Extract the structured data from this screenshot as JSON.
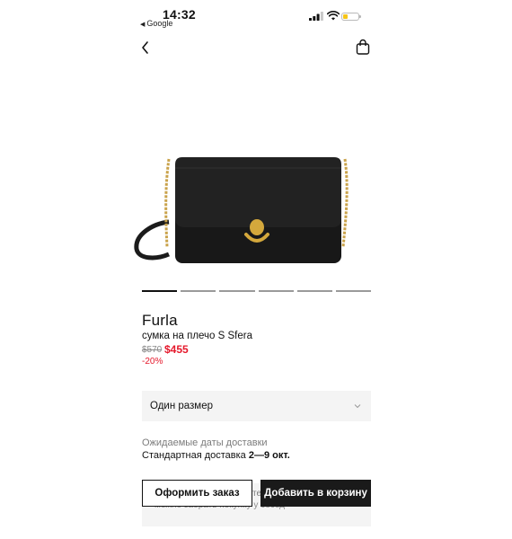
{
  "status_bar": {
    "time": "14:32",
    "back_app": "Google",
    "back_arrow": "◀",
    "icons": [
      "signal-icon",
      "wifi-icon",
      "battery-icon"
    ],
    "battery_color": "#f5c518"
  },
  "nav": {
    "back_icon": "chevron-left-icon",
    "bag_icon": "shopping-bag-icon"
  },
  "carousel": {
    "total": 6,
    "active_index": 0
  },
  "product": {
    "brand": "Furla",
    "name": "сумка на плечо S Sfera",
    "old_price": "$570",
    "price": "$455",
    "discount": "-20%",
    "image_icon": "black-shoulder-bag-with-gold-chain"
  },
  "size_select": {
    "value": "Один размер",
    "icon": "chevron-down-icon"
  },
  "delivery": {
    "title": "Ожидаемые даты доставки",
    "method": "Стандартная доставка",
    "dates": "2—9 окт."
  },
  "behind_buttons": {
    "line1": "те",
    "line2": "можно забрать покупку у сосед"
  },
  "actions": {
    "order": "Оформить заказ",
    "add_to_cart": "Добавить в корзину"
  },
  "colors": {
    "price_red": "#e5182b",
    "button_dark": "#1a1a1a",
    "panel_grey": "#f4f4f4"
  }
}
